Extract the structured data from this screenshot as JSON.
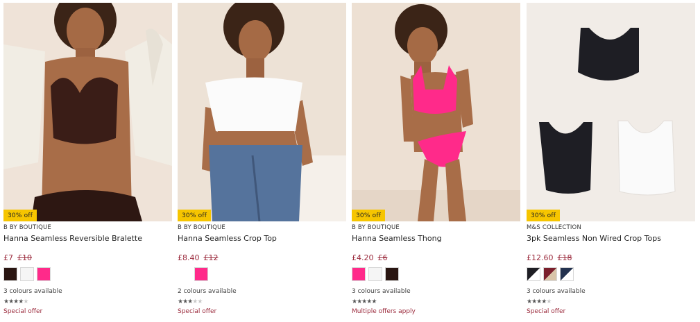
{
  "products": [
    {
      "badge": "30% off",
      "brand": "B BY BOUTIQUE",
      "title": "Hanna Seamless Reversible Bralette",
      "price_now": "£7",
      "price_was": "£10",
      "swatches": [
        "#2a1612",
        "#f5f5f5",
        "#ff2a8a"
      ],
      "colours_text": "3 colours available",
      "rating": 4,
      "offer": "Special offer",
      "image": "woman-brown-bralette"
    },
    {
      "badge": "30% off",
      "brand": "B BY BOUTIQUE",
      "title": "Hanna Seamless Crop Top",
      "price_now": "£8.40",
      "price_was": "£12",
      "swatches": [
        "#ffffff",
        "#ff2a8a"
      ],
      "colours_text": "2 colours available",
      "rating": 3,
      "offer": "Special offer",
      "image": "woman-white-crop-top"
    },
    {
      "badge": "30% off",
      "brand": "B BY BOUTIQUE",
      "title": "Hanna Seamless Thong",
      "price_now": "£4.20",
      "price_was": "£6",
      "swatches": [
        "#ff2a8a",
        "#f5f5f5",
        "#2a1612"
      ],
      "colours_text": "3 colours available",
      "rating": 4.5,
      "offer": "Multiple offers apply",
      "image": "woman-pink-set"
    },
    {
      "badge": "30% off",
      "brand": "M&S COLLECTION",
      "title": "3pk Seamless Non Wired Crop Tops",
      "price_now": "£12.60",
      "price_was": "£18",
      "swatches": [
        "multi-black-white",
        "multi-burgundy-beige",
        "multi-navy-white"
      ],
      "colours_text": "3 colours available",
      "rating": 4,
      "offer": "Special offer",
      "image": "three-crop-tops"
    }
  ]
}
